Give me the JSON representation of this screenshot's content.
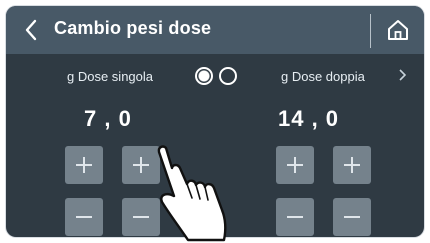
{
  "header": {
    "title": "Cambio pesi dose",
    "back_icon": "chevron-left-icon",
    "home_icon": "home-icon"
  },
  "single": {
    "label": "g Dose singola",
    "value": "7 , 0",
    "buttons": {
      "inc_a": "+",
      "inc_b": "+",
      "dec_a": "−",
      "dec_b": "−"
    }
  },
  "double": {
    "label": "g Dose doppia",
    "value": "14 , 0",
    "buttons": {
      "inc_a": "+",
      "inc_b": "+",
      "dec_a": "−",
      "dec_b": "−"
    }
  },
  "pager": {
    "selected_index": 0,
    "pages": 2,
    "next_icon": "chevron-right-icon"
  },
  "overlay": {
    "pointer_icon": "pointing-hand-icon"
  },
  "colors": {
    "screen_bg": "#2f3a43",
    "header_bg": "#485967",
    "button_bg": "#75828c",
    "text": "#ffffff"
  }
}
